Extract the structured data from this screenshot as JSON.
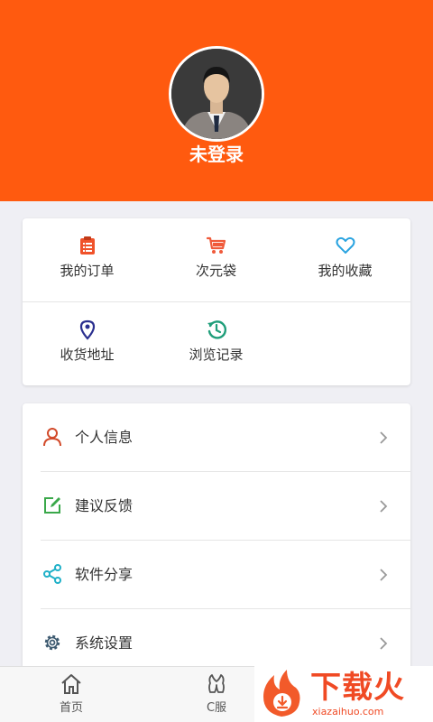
{
  "header": {
    "username": "未登录",
    "accent_color": "#ff5a0f"
  },
  "quick_menu": {
    "items": [
      {
        "label": "我的订单",
        "icon": "order-list-icon",
        "color": "#f0522a"
      },
      {
        "label": "次元袋",
        "icon": "shopping-cart-icon",
        "color": "#f05a3a"
      },
      {
        "label": "我的收藏",
        "icon": "heart-icon",
        "color": "#29a3e0"
      },
      {
        "label": "收货地址",
        "icon": "location-pin-icon",
        "color": "#2a2f8f"
      },
      {
        "label": "浏览记录",
        "icon": "history-clock-icon",
        "color": "#1f9e7a"
      }
    ]
  },
  "settings_list": {
    "items": [
      {
        "label": "个人信息",
        "icon": "person-icon",
        "color": "#d24a2a"
      },
      {
        "label": "建议反馈",
        "icon": "edit-icon",
        "color": "#3aa84a"
      },
      {
        "label": "软件分享",
        "icon": "share-icon",
        "color": "#1fb0c8"
      },
      {
        "label": "系统设置",
        "icon": "gear-icon",
        "color": "#3d5a70"
      }
    ]
  },
  "tabbar": {
    "tabs": [
      {
        "label": "首页",
        "icon": "home-icon"
      },
      {
        "label": "C服",
        "icon": "c-service-icon"
      }
    ]
  },
  "watermark": {
    "brand": "下载火",
    "url": "xiazaihuo.com"
  }
}
